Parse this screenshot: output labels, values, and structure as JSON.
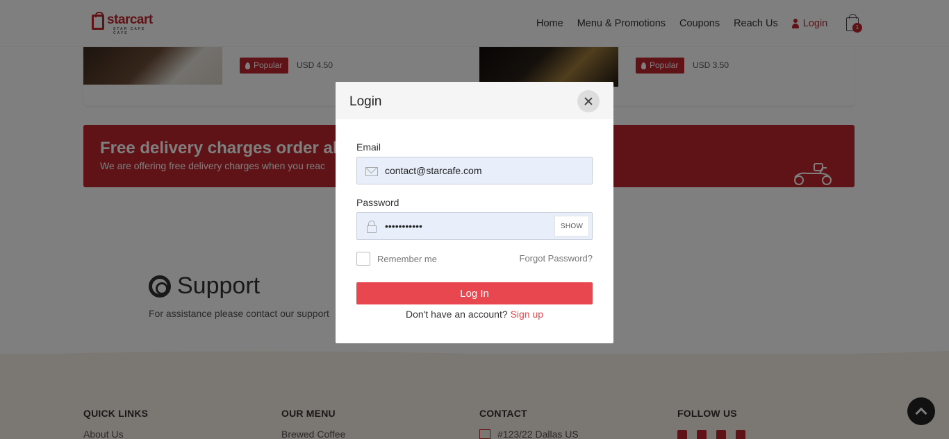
{
  "header": {
    "logo_text": "starcart",
    "logo_subtext": "STAR CAFE CAFE",
    "nav": [
      "Home",
      "Menu & Promotions",
      "Coupons",
      "Reach Us"
    ],
    "login_label": "Login",
    "cart_count": "1"
  },
  "products": [
    {
      "badge": "Popular",
      "price": "USD 4.50"
    },
    {
      "badge": "Popular",
      "price": "USD 3.50"
    }
  ],
  "promo": {
    "title": "Free delivery charges order ab",
    "text": "We are offering free delivery charges when you reac"
  },
  "support": {
    "title": "Support",
    "text": "For assistance please contact our support"
  },
  "footer": {
    "quick_links": {
      "heading": "QUICK LINKS",
      "first": "About Us"
    },
    "our_menu": {
      "heading": "OUR MENU",
      "first": "Brewed Coffee"
    },
    "contact": {
      "heading": "CONTACT",
      "first": "#123/22 Dallas US"
    },
    "follow_us": {
      "heading": "FOLLOW US"
    }
  },
  "modal": {
    "title": "Login",
    "email_label": "Email",
    "email_value": "contact@starcafe.com",
    "password_label": "Password",
    "password_value": "•••••••••••",
    "show_label": "SHOW",
    "remember_label": "Remember me",
    "forgot_label": "Forgot Password?",
    "login_button": "Log In",
    "signup_prompt": "Don't have an account?",
    "signup_link": "Sign up"
  },
  "colors": {
    "brand": "#c0262e",
    "login_button": "#e8474f",
    "field_bg": "#e8effb"
  }
}
